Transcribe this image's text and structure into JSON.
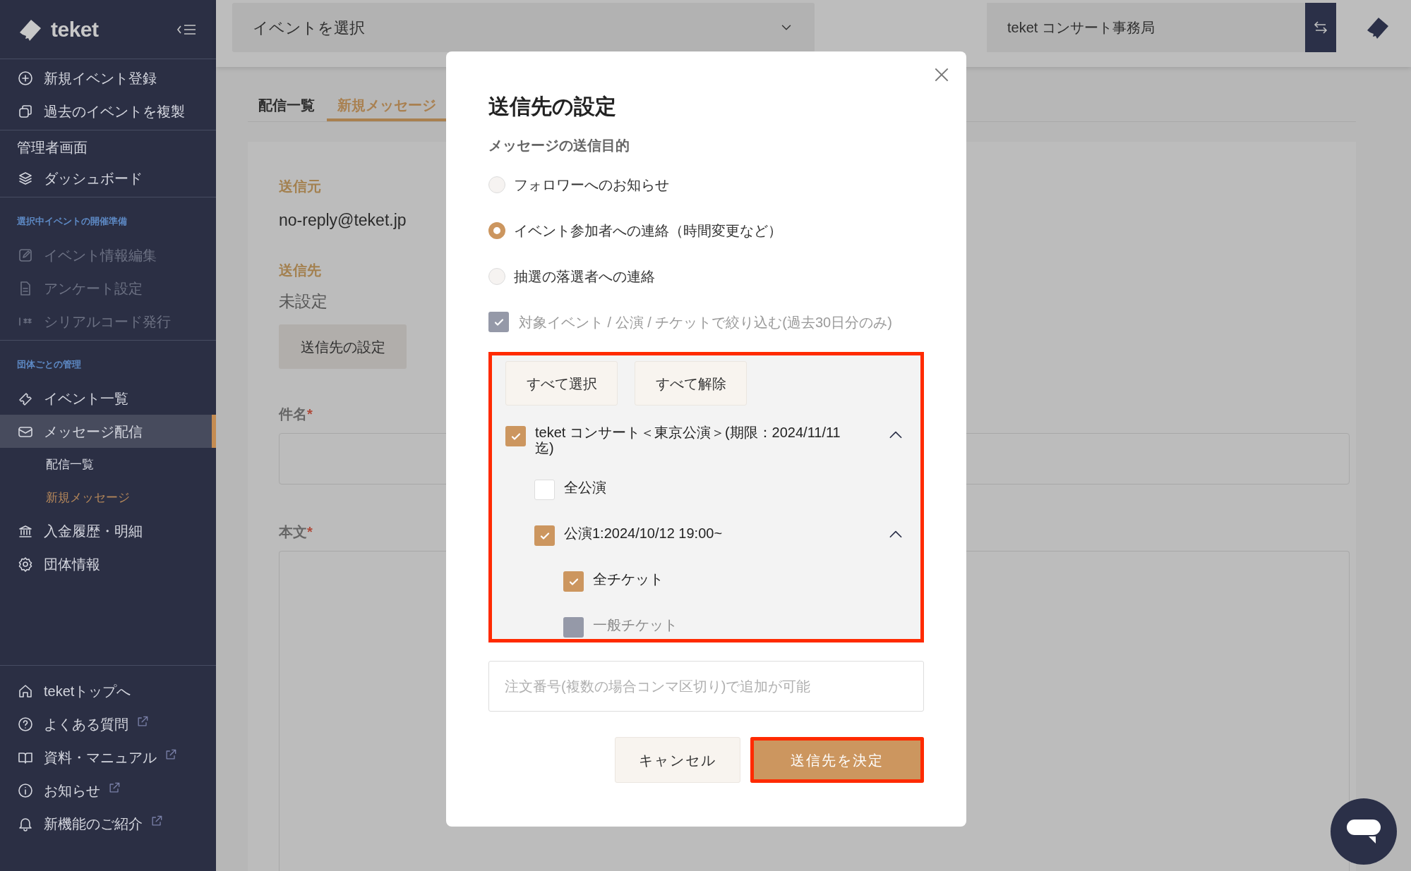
{
  "sidebar": {
    "logo": "teket",
    "groups": [
      {
        "items": [
          {
            "label": "新規イベント登録",
            "selected": false,
            "disabled": false
          },
          {
            "label": "過去のイベントを複製",
            "selected": false,
            "disabled": false
          }
        ]
      },
      {
        "title": "管理者画面",
        "items": [
          {
            "label": "ダッシュボード",
            "selected": false,
            "disabled": false
          }
        ]
      },
      {
        "heading": "選択中イベントの開催準備",
        "items": [
          {
            "label": "イベント情報編集",
            "selected": false,
            "disabled": true
          },
          {
            "label": "アンケート設定",
            "selected": false,
            "disabled": true
          },
          {
            "label": "シリアルコード発行",
            "selected": false,
            "disabled": true
          }
        ]
      },
      {
        "heading": "団体ごとの管理",
        "items": [
          {
            "label": "イベント一覧",
            "selected": false,
            "disabled": false
          },
          {
            "label": "メッセージ配信",
            "selected": true,
            "disabled": false,
            "children": [
              {
                "label": "配信一覧",
                "selected": false
              },
              {
                "label": "新規メッセージ",
                "selected": true
              }
            ]
          },
          {
            "label": "入金履歴・明細",
            "selected": false,
            "disabled": false
          },
          {
            "label": "団体情報",
            "selected": false,
            "disabled": false
          }
        ]
      }
    ],
    "footer": [
      {
        "label": "teketトップへ",
        "external": false
      },
      {
        "label": "よくある質問",
        "external": true
      },
      {
        "label": "資料・マニュアル",
        "external": true
      },
      {
        "label": "お知らせ",
        "external": true
      },
      {
        "label": "新機能のご紹介",
        "external": true
      }
    ]
  },
  "topbar": {
    "event_select": "イベントを選択",
    "org_select": "teket コンサート事務局"
  },
  "tabs": [
    {
      "label": "配信一覧",
      "selected": false
    },
    {
      "label": "新規メッセージ",
      "selected": true
    }
  ],
  "form": {
    "sender_label": "送信元",
    "sender": "no-reply@teket.jp",
    "recipient_label": "送信先",
    "recipient": "未設定",
    "recipient_button": "送信先の設定",
    "subject": {
      "label": "件名",
      "mark": "*"
    },
    "body": {
      "label": "本文",
      "mark": "*"
    }
  },
  "dialog": {
    "title": "送信先の設定",
    "purpose_label": "メッセージの送信目的",
    "purposes": [
      {
        "label": "フォロワーへのお知らせ",
        "selected": false
      },
      {
        "label": "イベント参加者への連絡（時間変更など）",
        "selected": true
      },
      {
        "label": "抽選の落選者への連絡",
        "selected": false
      }
    ],
    "filter": {
      "label": "対象イベント / 公演 / チケットで絞り込む(過去30日分のみ)",
      "checked": true,
      "disabled": true
    },
    "target_panel": {
      "highlighted": true,
      "buttons": [
        "すべて選択",
        "すべて解除"
      ],
      "tree": [
        {
          "label": "teket コンサート＜東京公演＞(期限：2024/11/11迄)",
          "checked": true,
          "disabled": false,
          "expanded": true,
          "children": [
            {
              "label": "全公演",
              "checked": false,
              "disabled": false
            },
            {
              "label": "公演1:2024/10/12 19:00~",
              "checked": true,
              "disabled": false,
              "expanded": true,
              "children": [
                {
                  "label": "全チケット",
                  "checked": true,
                  "disabled": false
                },
                {
                  "label": "一般チケット",
                  "checked": false,
                  "disabled": true
                }
              ]
            }
          ]
        }
      ]
    },
    "order_field": {
      "placeholder": "注文番号(複数の場合コンマ区切り)で追加が可能"
    },
    "buttons": [
      {
        "label": "キャンセル",
        "kind": "secondary",
        "highlighted": false
      },
      {
        "label": "送信先を決定",
        "kind": "primary",
        "highlighted": true
      }
    ]
  }
}
